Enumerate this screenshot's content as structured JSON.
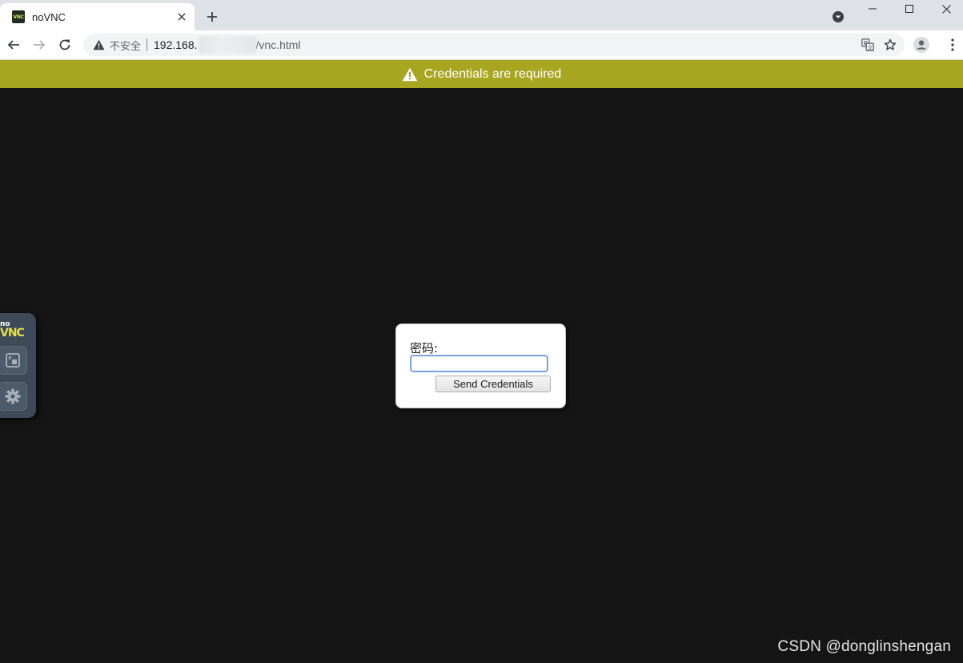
{
  "browser": {
    "tab": {
      "title": "noVNC",
      "favicon_text": "VNC"
    },
    "security_label": "不安全",
    "url": {
      "host": "192.168.",
      "path": "/vnc.html"
    }
  },
  "status": {
    "message": "Credentials are required",
    "color": "#a8a520"
  },
  "control_bar": {
    "logo_top": "no",
    "logo_bottom": "VNC"
  },
  "dialog": {
    "password_label": "密码:",
    "password_value": "",
    "send_button": "Send Credentials"
  },
  "watermark": "CSDN @donglinshengan"
}
